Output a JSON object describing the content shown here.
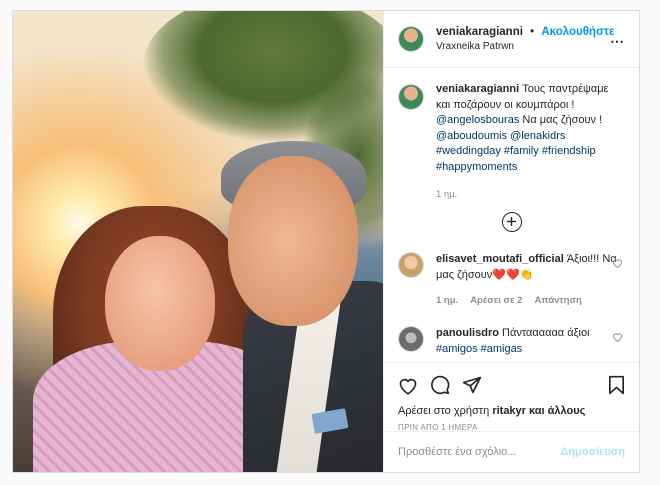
{
  "post": {
    "author": "veniakaragianni",
    "dot": "•",
    "follow_label": "Ακολουθήστε",
    "location": "Vraxneika Patrwn",
    "more_icon": "⋯",
    "caption": {
      "username": "veniakaragianni",
      "line1": "Τους παντρέψαμε και ποζάρουν οι κουμπάροι !",
      "mention1": "@angelosbouras",
      "line2": "Να μας ζήσουν !",
      "mention2": "@aboudoumis",
      "mention3": "@lenakidrs",
      "tag1": "#weddingday",
      "tag2": "#family",
      "tag3": "#friendship",
      "tag4": "#happymoments"
    },
    "caption_time": "1 ημ.",
    "load_more_icon": "⊕"
  },
  "comments": [
    {
      "username": "elisavet_moutafi_official",
      "text": "Άξιοι!!! Να μας ζήσουν❤️❤️👏",
      "time": "1 ημ.",
      "likes": "Αρέσει σε 2",
      "reply": "Απάντηση"
    },
    {
      "username": "panoulisdro",
      "text": "Πάνταααααα άξιοι",
      "tag1": "#amigos",
      "tag2": "#amigas"
    }
  ],
  "actions": {
    "likes_prefix": "Αρέσει στο χρήστη",
    "likes_user": "ritakyr",
    "likes_suffix": "και άλλους",
    "posted_ago": "ΠΡΙΝ ΑΠΟ 1 ΗΜΕΡΑ"
  },
  "add_comment": {
    "placeholder": "Προσθέστε ένα σχόλιο...",
    "post_label": "Δημοσίευση"
  },
  "colors": {
    "accent": "#0095f6",
    "post_disabled": "#b2dffc",
    "link": "#00376b"
  }
}
